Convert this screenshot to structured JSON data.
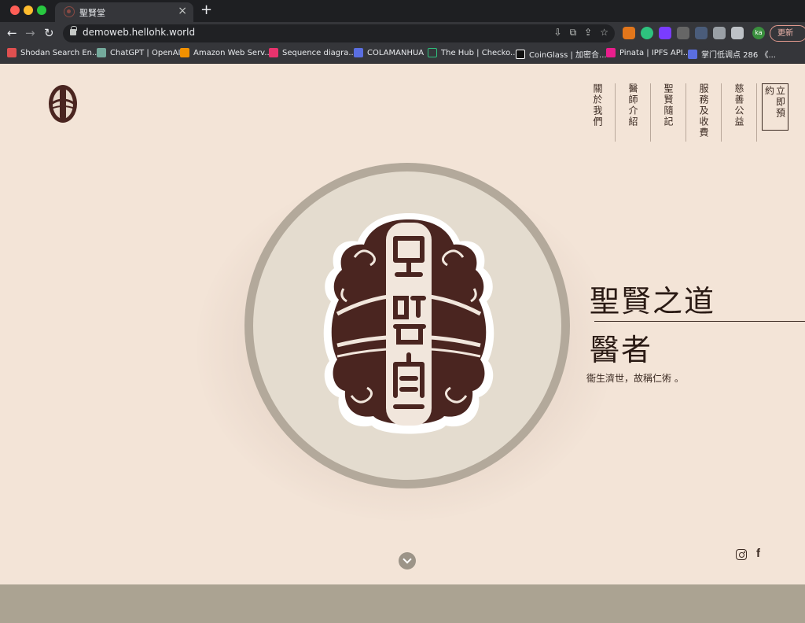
{
  "browser": {
    "tab_title": "聖賢堂",
    "tab_close": "×",
    "new_tab": "+",
    "url": "demoweb.hellohk.world",
    "update_label": "更新",
    "avatar_initials": "ka",
    "bookmarks": [
      {
        "label": "Shodan Search En...",
        "color": "#e05050"
      },
      {
        "label": "ChatGPT | OpenAI",
        "color": "#74aa9c"
      },
      {
        "label": "Amazon Web Serv...",
        "color": "#f29100"
      },
      {
        "label": "Sequence diagra...",
        "color": "#e8336d"
      },
      {
        "label": "COLAMANHUA",
        "color": "#5a6ee0"
      },
      {
        "label": "The Hub | Checko...",
        "color": "#35363a"
      },
      {
        "label": "CoinGlass | 加密合...",
        "color": "#111111"
      },
      {
        "label": "Pinata | IPFS API...",
        "color": "#e91e8c"
      },
      {
        "label": "掌门低调点 286 《...",
        "color": "#5a6ee0"
      }
    ]
  },
  "site": {
    "nav": [
      {
        "label": "關於我們"
      },
      {
        "label": "醫師介紹"
      },
      {
        "label": "聖賢隨記"
      },
      {
        "label": "服務及收費"
      },
      {
        "label": "慈善公益"
      },
      {
        "label": "立即預約"
      }
    ],
    "hero": {
      "title": "聖賢之道",
      "subtitle": "醫者",
      "description": "衞生濟世，故稱仁術 。",
      "emblem_chars": "聖賢堂"
    },
    "colors": {
      "background": "#f3e4d7",
      "brand_brown": "#4a2520",
      "disc": "#e4dccf",
      "ring": "#b3a99b",
      "band": "#aba392"
    }
  }
}
